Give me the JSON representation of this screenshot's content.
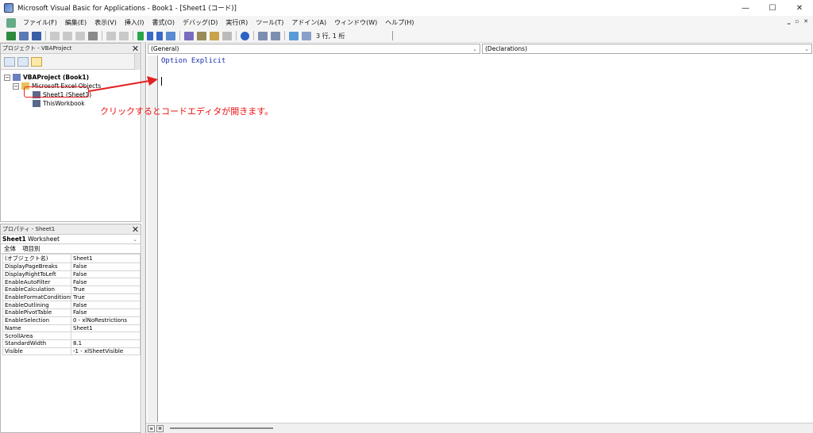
{
  "window": {
    "title": "Microsoft Visual Basic for Applications - Book1 - [Sheet1 (コード)]",
    "controls": [
      "—",
      "☐",
      "✕"
    ]
  },
  "menu": {
    "items": [
      "ファイル(F)",
      "編集(E)",
      "表示(V)",
      "挿入(I)",
      "書式(O)",
      "デバッグ(D)",
      "実行(R)",
      "ツール(T)",
      "アドイン(A)",
      "ウィンドウ(W)",
      "ヘルプ(H)"
    ],
    "mdi_controls": [
      "‗",
      "▫",
      "✕"
    ]
  },
  "toolbar": {
    "position_status": "3 行, 1 桁"
  },
  "project": {
    "header": "プロジェクト - VBAProject",
    "tree": {
      "root": "VBAProject (Book1)",
      "folder": "Microsoft Excel Objects",
      "sheet": "Sheet1 (Sheet1)",
      "workbook": "ThisWorkbook"
    }
  },
  "properties": {
    "header": "プロパティ - Sheet1",
    "object_name": "Sheet1",
    "object_type": "Worksheet",
    "tabs": [
      "全体",
      "項目別"
    ],
    "rows": [
      {
        "name": "(オブジェクト名)",
        "value": "Sheet1"
      },
      {
        "name": "DisplayPageBreaks",
        "value": "False"
      },
      {
        "name": "DisplayRightToLeft",
        "value": "False"
      },
      {
        "name": "EnableAutoFilter",
        "value": "False"
      },
      {
        "name": "EnableCalculation",
        "value": "True"
      },
      {
        "name": "EnableFormatConditionsCalculation",
        "value": "True"
      },
      {
        "name": "EnableOutlining",
        "value": "False"
      },
      {
        "name": "EnablePivotTable",
        "value": "False"
      },
      {
        "name": "EnableSelection",
        "value": "0 - xlNoRestrictions"
      },
      {
        "name": "Name",
        "value": "Sheet1"
      },
      {
        "name": "ScrollArea",
        "value": ""
      },
      {
        "name": "StandardWidth",
        "value": "8.1"
      },
      {
        "name": "Visible",
        "value": "-1 - xlSheetVisible"
      }
    ]
  },
  "code": {
    "object_combo": "(General)",
    "procedure_combo": "(Declarations)",
    "lines": [
      "Option Explicit"
    ]
  },
  "annotation": {
    "text": "クリックするとコードエディタが開きます。",
    "color": "#e22222"
  }
}
